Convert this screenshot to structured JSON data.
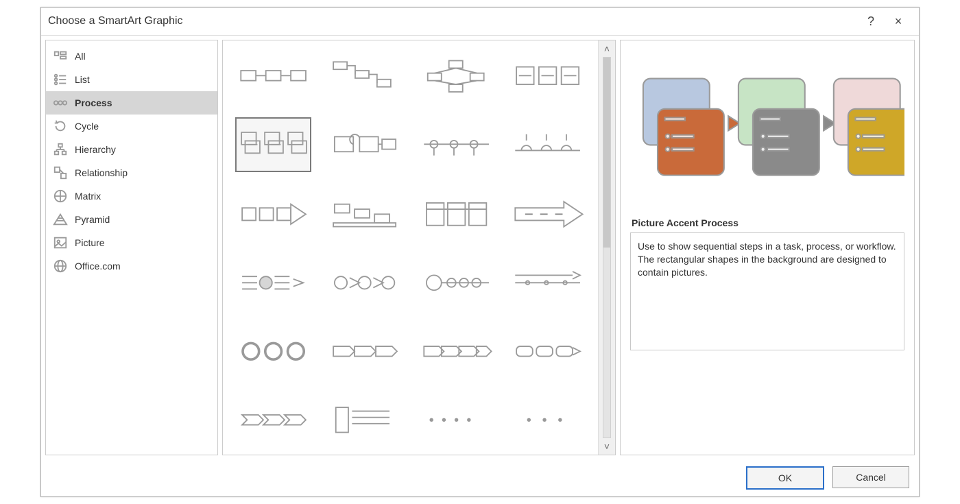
{
  "dialog": {
    "title": "Choose a SmartArt Graphic"
  },
  "titlebar": {
    "help": "?",
    "close": "×"
  },
  "categories": [
    {
      "id": "all",
      "label": "All",
      "icon": "all-icon"
    },
    {
      "id": "list",
      "label": "List",
      "icon": "list-icon"
    },
    {
      "id": "process",
      "label": "Process",
      "icon": "process-icon",
      "selected": true
    },
    {
      "id": "cycle",
      "label": "Cycle",
      "icon": "cycle-icon"
    },
    {
      "id": "hierarchy",
      "label": "Hierarchy",
      "icon": "hierarchy-icon"
    },
    {
      "id": "relationship",
      "label": "Relationship",
      "icon": "relationship-icon"
    },
    {
      "id": "matrix",
      "label": "Matrix",
      "icon": "matrix-icon"
    },
    {
      "id": "pyramid",
      "label": "Pyramid",
      "icon": "pyramid-icon"
    },
    {
      "id": "picture",
      "label": "Picture",
      "icon": "picture-icon"
    },
    {
      "id": "officecom",
      "label": "Office.com",
      "icon": "globe-icon"
    }
  ],
  "gallery": {
    "selected": "picture-accent-process",
    "items": [
      "basic-process",
      "step-down-process",
      "alternating-flow",
      "picture-strip-process",
      "picture-accent-process",
      "detailed-process",
      "circle-accent-timeline",
      "half-circle-timeline",
      "chevron-process",
      "sub-step-process",
      "tabbed-process",
      "continuous-arrow-process",
      "process-arrows",
      "chevron-list",
      "circle-timeline",
      "basic-timeline",
      "circle-process",
      "pill-chevron",
      "segmented-chevron",
      "segmented-process",
      "closed-chevron",
      "vertical-list-process",
      "dotted-process-1",
      "dotted-process-2"
    ]
  },
  "preview": {
    "title": "Picture Accent Process",
    "description": "Use to show sequential steps in a task, process, or workflow. The rectangular shapes in the background are designed to contain pictures.",
    "cards": [
      {
        "back": "#b8c8e0",
        "front": "#c96a3a"
      },
      {
        "back": "#c7e4c5",
        "front": "#8a8a8a"
      },
      {
        "back": "#efd9d9",
        "front": "#cfa728"
      }
    ]
  },
  "buttons": {
    "ok": "OK",
    "cancel": "Cancel"
  }
}
